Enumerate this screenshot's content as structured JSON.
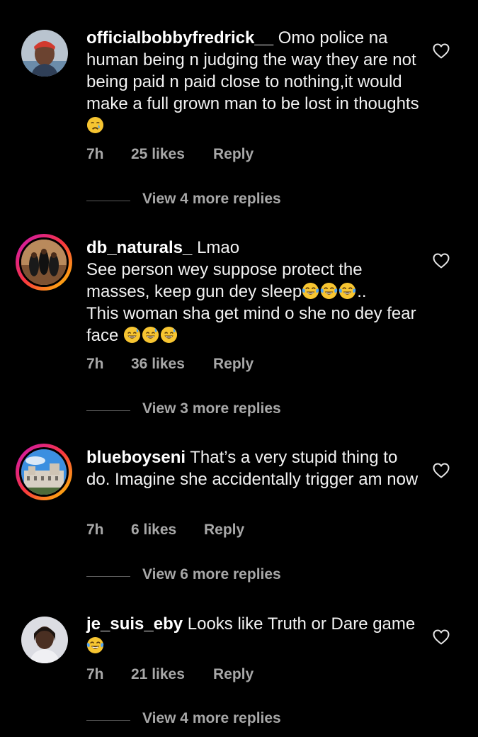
{
  "comments": [
    {
      "username": "officialbobbyfredrick__",
      "text_line1": "Omo police na",
      "text_rest": "human being n judging the way they are not being paid n paid close to nothing,it would make a full grown man to be lost in thoughts",
      "time": "7h",
      "likes": "25 likes",
      "reply": "Reply",
      "view_replies": "View 4 more replies",
      "avatar_icon": "profile-photo-man-red-cap",
      "emoji_icon": "crying-face-emoji"
    },
    {
      "username": "db_naturals_",
      "text_line1": "Lmao",
      "text_rest": "See person wey suppose protect the masses, keep gun dey sleep",
      "text_after_emojis": "..",
      "text_line4": "This woman sha get mind o she no dey fear face",
      "time": "7h",
      "likes": "36 likes",
      "reply": "Reply",
      "view_replies": "View 3 more replies",
      "avatar_icon": "profile-photo-three-women",
      "emoji_icon": "tears-of-joy-emoji",
      "emoji_icon_2": "grinning-sweat-emoji"
    },
    {
      "username": "blueboyseni",
      "text_line1": "That’s a very stupid thing to do. Imagine she accidentally trigger am now",
      "time": "7h",
      "likes": "6 likes",
      "reply": "Reply",
      "view_replies": "View 6 more replies",
      "avatar_icon": "profile-photo-building-sky"
    },
    {
      "username": "je_suis_eby",
      "text_line1": "Looks like Truth or Dare game",
      "time": "7h",
      "likes": "21 likes",
      "reply": "Reply",
      "view_replies": "View 4 more replies",
      "avatar_icon": "profile-photo-woman",
      "emoji_icon": "tears-of-joy-emoji"
    }
  ],
  "colors": {
    "background": "#000000",
    "text": "#f2f2f2",
    "secondary": "#a8a8a8",
    "story_ring_start": "#c913b9",
    "story_ring_end": "#fecd00"
  }
}
